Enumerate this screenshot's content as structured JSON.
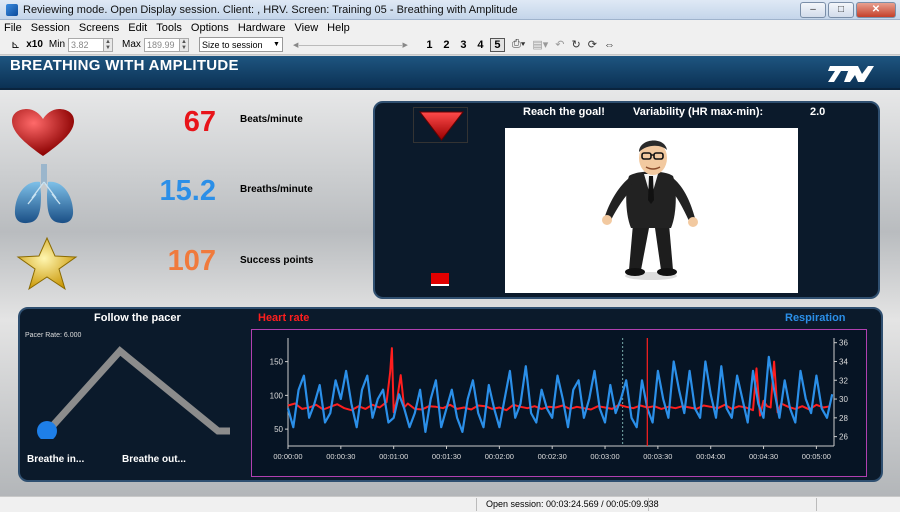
{
  "window": {
    "title": "Reviewing mode. Open Display session. Client: , HRV. Screen: Training 05 - Breathing with Amplitude",
    "minimize": "–",
    "restore": "□",
    "close": "✕"
  },
  "menu": [
    "File",
    "Session",
    "Screens",
    "Edit",
    "Tools",
    "Options",
    "Hardware",
    "View",
    "Help"
  ],
  "toolbar": {
    "scale_label": "x10",
    "min_label": "Min",
    "min_value": "3.82",
    "max_label": "Max",
    "max_value": "189.99",
    "size_select": "Size to session",
    "pages": [
      "1",
      "2",
      "3",
      "4",
      "5"
    ],
    "active_page": "5"
  },
  "screen": {
    "title": "BREATHING WITH AMPLITUDE"
  },
  "stats": [
    {
      "value": "67",
      "label": "Beats/minute",
      "color": "#e8141a",
      "icon": "heart-icon"
    },
    {
      "value": "15.2",
      "label": "Breaths/minute",
      "color": "#2b8fe8",
      "icon": "lungs-icon"
    },
    {
      "value": "107",
      "label": "Success points",
      "color": "#f07a3c",
      "icon": "star-icon"
    }
  ],
  "goal": {
    "reach": "Reach the goal!",
    "variability_label": "Variability (HR max-min):",
    "variability_value": "2.0"
  },
  "pacer": {
    "title": "Follow the pacer",
    "rate": "Pacer Rate: 6.000",
    "breathe_in": "Breathe in...",
    "breathe_out": "Breathe out..."
  },
  "chart_data": {
    "type": "line",
    "title": "",
    "left_title": "Heart rate",
    "right_title": "Respiration",
    "x_ticks": [
      "00:00:00",
      "00:00:30",
      "00:01:00",
      "00:01:30",
      "00:02:00",
      "00:02:30",
      "00:03:00",
      "00:03:30",
      "00:04:00",
      "00:04:30",
      "00:05:00"
    ],
    "y_left_ticks": [
      50,
      100,
      150
    ],
    "y_left_range": [
      25,
      185
    ],
    "y_right_ticks": [
      26,
      28,
      30,
      32,
      34,
      36
    ],
    "y_right_range": [
      25,
      36.5
    ],
    "x_range_seconds": [
      0,
      310
    ],
    "cursor_seconds": 204,
    "session_marker_seconds": 190,
    "series": [
      {
        "name": "Heart rate",
        "color": "#ff1e1e",
        "axis": "left",
        "x": [
          0,
          4,
          8,
          12,
          16,
          20,
          24,
          28,
          32,
          36,
          40,
          44,
          48,
          52,
          56,
          58,
          59,
          60,
          62,
          64,
          66,
          68,
          72,
          76,
          80,
          84,
          88,
          92,
          96,
          100,
          104,
          108,
          112,
          116,
          120,
          124,
          128,
          132,
          136,
          140,
          144,
          148,
          152,
          156,
          160,
          164,
          168,
          172,
          176,
          180,
          184,
          188,
          192,
          196,
          200,
          204,
          208,
          212,
          216,
          220,
          224,
          228,
          232,
          236,
          240,
          244,
          248,
          252,
          256,
          260,
          264,
          266,
          268,
          270,
          272,
          274,
          276,
          278,
          280,
          284,
          288,
          292,
          296,
          300,
          304,
          308
        ],
        "values": [
          85,
          88,
          80,
          82,
          86,
          79,
          83,
          87,
          81,
          78,
          84,
          80,
          86,
          82,
          90,
          135,
          170,
          75,
          95,
          130,
          82,
          88,
          80,
          79,
          84,
          83,
          81,
          86,
          80,
          82,
          79,
          85,
          84,
          80,
          82,
          78,
          86,
          83,
          81,
          84,
          80,
          83,
          82,
          85,
          80,
          83,
          81,
          79,
          84,
          82,
          80,
          86,
          83,
          81,
          85,
          82,
          84,
          80,
          83,
          81,
          84,
          82,
          80,
          85,
          83,
          81,
          86,
          80,
          84,
          82,
          78,
          140,
          70,
          92,
          84,
          82,
          150,
          75,
          88,
          83,
          80,
          84,
          79,
          86,
          82,
          84
        ]
      },
      {
        "name": "Respiration",
        "color": "#2b8fe8",
        "axis": "right",
        "x": [
          0,
          3,
          6,
          9,
          12,
          15,
          18,
          21,
          24,
          27,
          30,
          33,
          36,
          39,
          42,
          45,
          48,
          51,
          54,
          57,
          60,
          63,
          66,
          69,
          72,
          75,
          78,
          81,
          84,
          87,
          90,
          93,
          96,
          99,
          102,
          105,
          108,
          111,
          114,
          117,
          120,
          123,
          126,
          129,
          132,
          135,
          138,
          141,
          144,
          147,
          150,
          153,
          156,
          159,
          162,
          165,
          168,
          171,
          174,
          177,
          180,
          183,
          186,
          189,
          192,
          195,
          198,
          201,
          204,
          207,
          210,
          213,
          216,
          219,
          222,
          225,
          228,
          231,
          234,
          237,
          240,
          243,
          246,
          249,
          252,
          255,
          258,
          261,
          264,
          267,
          270,
          273,
          276,
          279,
          282,
          285,
          288,
          291,
          294,
          297,
          300,
          303,
          306,
          309
        ],
        "values": [
          29,
          27,
          31,
          32.5,
          28,
          29.5,
          31.5,
          27.5,
          28.5,
          32,
          30,
          33,
          29.5,
          27,
          31,
          32.5,
          28,
          30,
          31,
          27.5,
          28,
          30.5,
          29,
          27,
          28.5,
          31,
          26.5,
          30,
          32,
          27,
          29,
          31,
          28,
          26.5,
          30,
          32,
          28.5,
          27,
          31.5,
          29,
          27,
          30,
          33,
          28,
          29.5,
          33.5,
          28.5,
          27.5,
          31,
          29,
          28,
          32.5,
          30,
          27,
          31,
          32,
          28,
          30,
          33,
          29,
          27.5,
          31.5,
          28.5,
          30,
          32,
          28,
          27,
          32,
          29,
          27.5,
          33,
          30,
          28,
          34,
          31,
          28.5,
          33,
          29,
          28,
          34,
          30.5,
          28,
          33.5,
          29,
          28,
          32.5,
          30,
          27.5,
          33,
          29.5,
          28,
          34.5,
          31,
          28,
          32,
          29,
          27.5,
          33,
          30,
          28.5,
          32.5,
          29,
          28,
          30.5
        ]
      }
    ]
  }
}
